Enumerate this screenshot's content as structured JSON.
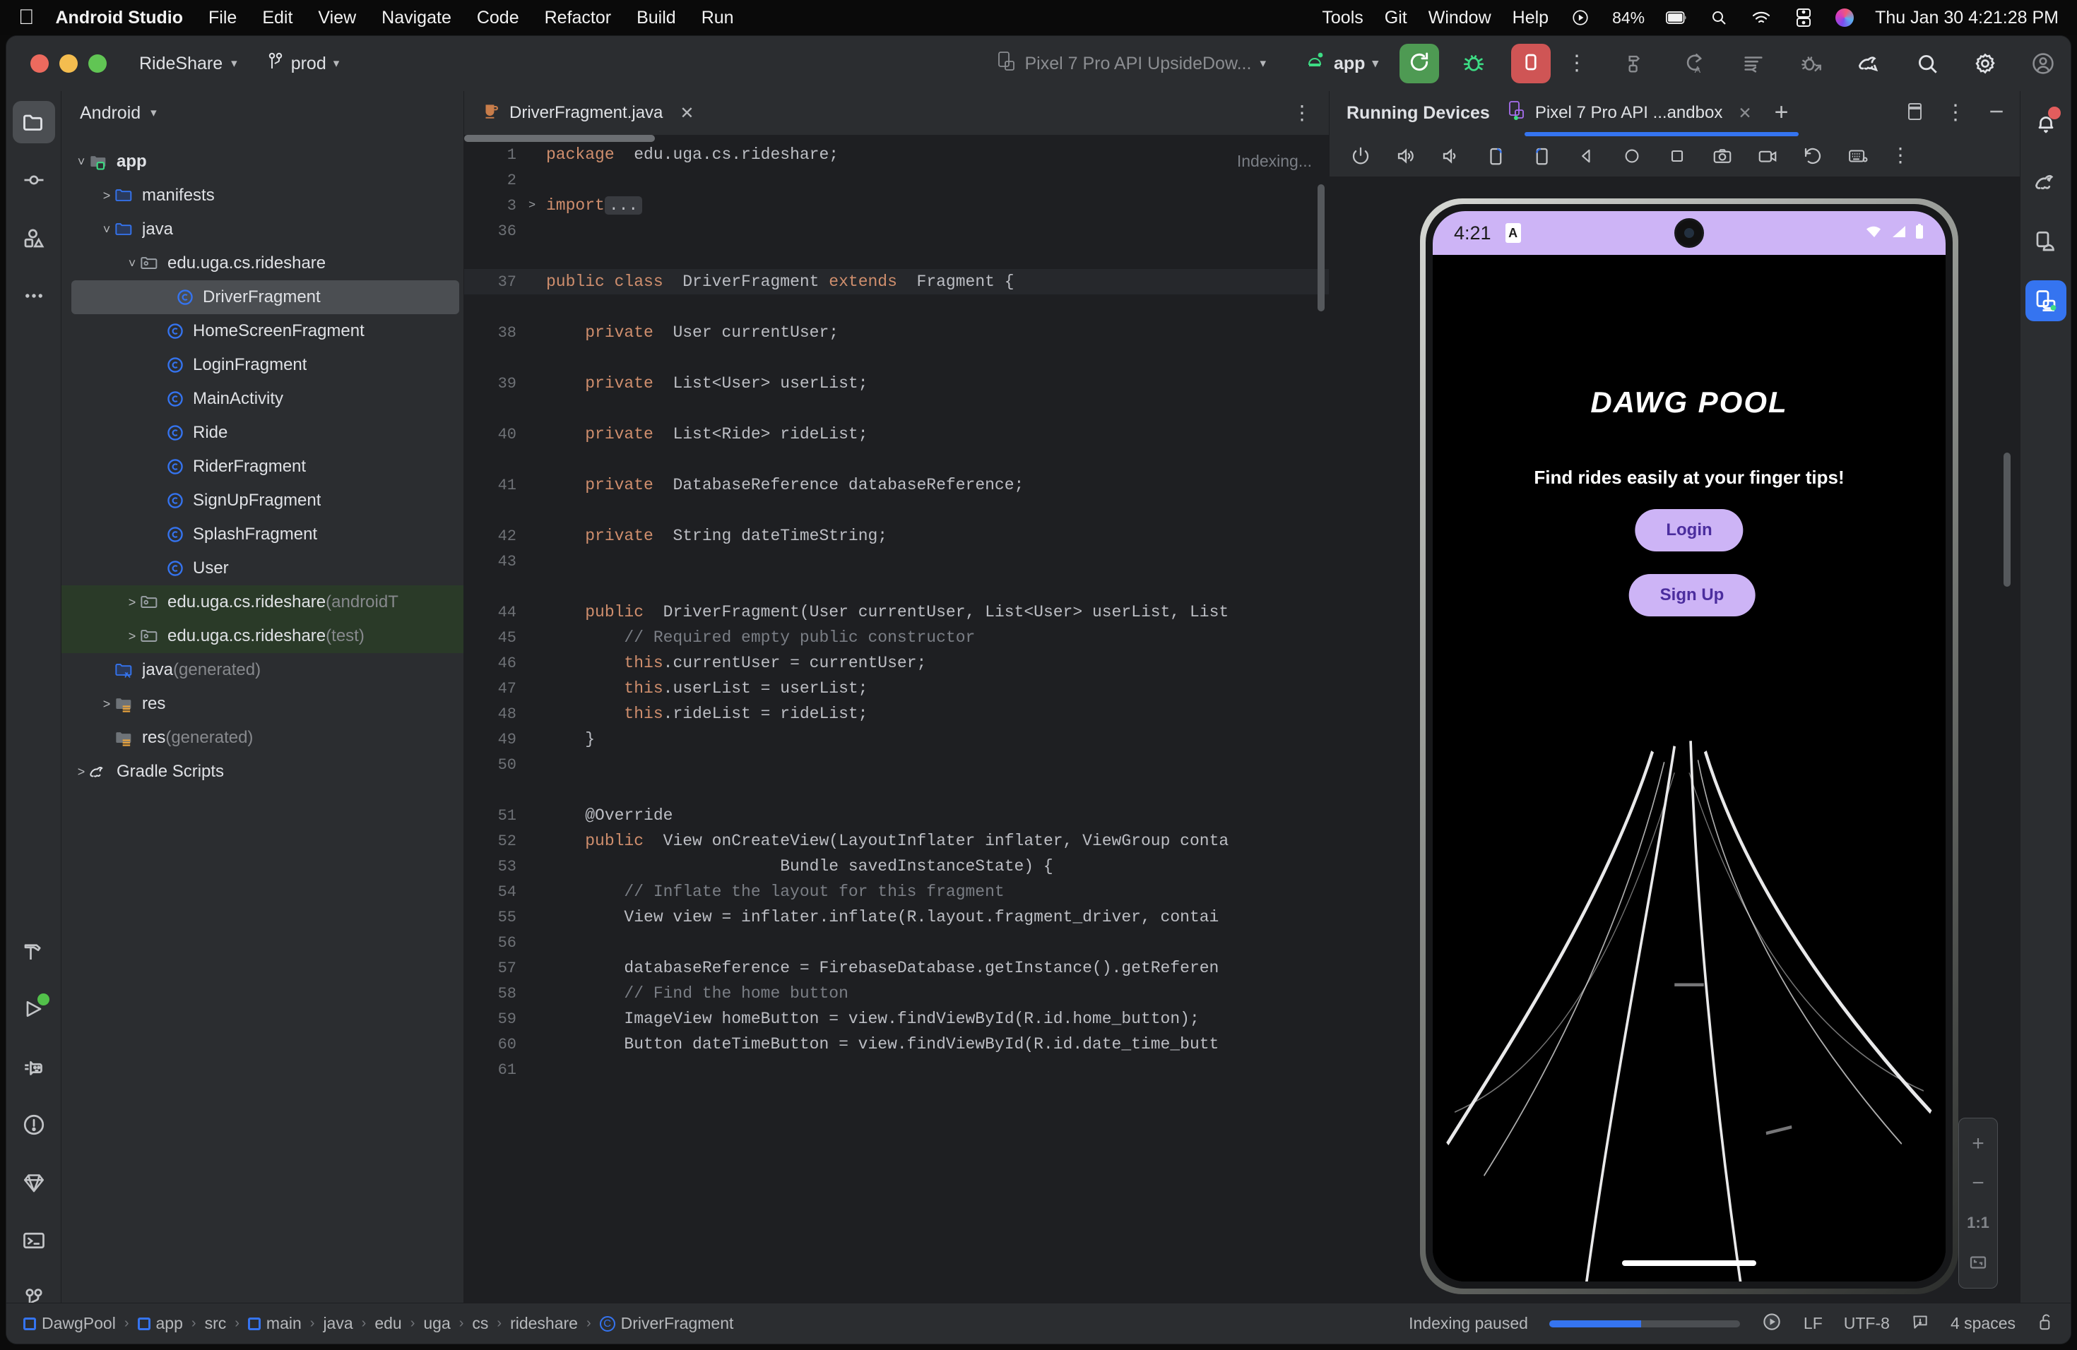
{
  "macos": {
    "apple_icon": "apple-logo-icon",
    "app_name": "Android Studio",
    "menus": [
      "File",
      "Edit",
      "View",
      "Navigate",
      "Code",
      "Refactor",
      "Build",
      "Run"
    ],
    "right_menus": [
      "Tools",
      "Git",
      "Window",
      "Help"
    ],
    "battery_percent": "84%",
    "datetime": "Thu Jan 30  4:21:28 PM",
    "icons": [
      "control-center-play-icon",
      "battery-icon",
      "search-icon",
      "wifi-icon",
      "control-center-icon",
      "siri-icon"
    ]
  },
  "toolbar": {
    "project_name": "RideShare",
    "branch_name": "prod",
    "device_target": "Pixel 7 Pro API UpsideDow...",
    "run_config": "app",
    "run_button": "run-icon",
    "debug_button": "debug-icon",
    "stop_button": "stop-icon",
    "more_button": "more-vertical-icon",
    "right_icons": [
      "build-icon",
      "code-with-me-icon",
      "format-icon",
      "debug-attach-icon",
      "gradle-sync-icon",
      "search-everywhere-icon",
      "settings-icon",
      "account-icon"
    ]
  },
  "left_toolbar": {
    "items": [
      {
        "name": "project",
        "icon": "folder-icon",
        "active": true
      },
      {
        "name": "commit",
        "icon": "commit-icon",
        "active": false
      },
      {
        "name": "resource-manager",
        "icon": "shapes-icon",
        "active": false
      },
      {
        "name": "more-tool-windows",
        "icon": "ellipsis-icon",
        "active": false
      }
    ],
    "bottom_items": [
      {
        "name": "build",
        "icon": "hammer-icon"
      },
      {
        "name": "run",
        "icon": "play-icon",
        "badge": true
      },
      {
        "name": "logcat",
        "icon": "cat-icon"
      },
      {
        "name": "problems",
        "icon": "warning-circle-icon"
      },
      {
        "name": "app-quality-insights",
        "icon": "diamond-icon"
      },
      {
        "name": "terminal",
        "icon": "terminal-icon"
      },
      {
        "name": "version-control",
        "icon": "branch-icon"
      }
    ]
  },
  "right_toolbar": {
    "items": [
      {
        "name": "notifications",
        "icon": "bell-icon",
        "badge": true,
        "active": false
      },
      {
        "name": "gradle",
        "icon": "gradle-elephant-icon",
        "badge": false,
        "active": false
      },
      {
        "name": "device-manager",
        "icon": "device-android-icon",
        "badge": false,
        "active": false
      },
      {
        "name": "running-devices",
        "icon": "running-devices-icon",
        "badge": true,
        "active": true
      }
    ]
  },
  "project_panel": {
    "title": "Android",
    "tree": [
      {
        "indent": 0,
        "twisty": "down",
        "icon": "module-folder-icon",
        "label": "app",
        "suffix": "",
        "bold": true,
        "selected": false,
        "scope": false
      },
      {
        "indent": 1,
        "twisty": "right",
        "icon": "folder-blue-icon",
        "label": "manifests",
        "suffix": "",
        "bold": false,
        "selected": false,
        "scope": false
      },
      {
        "indent": 1,
        "twisty": "down",
        "icon": "folder-blue-icon",
        "label": "java",
        "suffix": "",
        "bold": false,
        "selected": false,
        "scope": false
      },
      {
        "indent": 2,
        "twisty": "down",
        "icon": "package-icon",
        "label": "edu.uga.cs.rideshare",
        "suffix": "",
        "bold": false,
        "selected": false,
        "scope": false
      },
      {
        "indent": 3,
        "twisty": "none",
        "icon": "java-class-icon",
        "label": "DriverFragment",
        "suffix": "",
        "bold": false,
        "selected": true,
        "scope": false
      },
      {
        "indent": 3,
        "twisty": "none",
        "icon": "java-class-icon",
        "label": "HomeScreenFragment",
        "suffix": "",
        "bold": false,
        "selected": false,
        "scope": false
      },
      {
        "indent": 3,
        "twisty": "none",
        "icon": "java-class-icon",
        "label": "LoginFragment",
        "suffix": "",
        "bold": false,
        "selected": false,
        "scope": false
      },
      {
        "indent": 3,
        "twisty": "none",
        "icon": "java-class-icon",
        "label": "MainActivity",
        "suffix": "",
        "bold": false,
        "selected": false,
        "scope": false
      },
      {
        "indent": 3,
        "twisty": "none",
        "icon": "java-class-icon",
        "label": "Ride",
        "suffix": "",
        "bold": false,
        "selected": false,
        "scope": false
      },
      {
        "indent": 3,
        "twisty": "none",
        "icon": "java-class-icon",
        "label": "RiderFragment",
        "suffix": "",
        "bold": false,
        "selected": false,
        "scope": false
      },
      {
        "indent": 3,
        "twisty": "none",
        "icon": "java-class-icon",
        "label": "SignUpFragment",
        "suffix": "",
        "bold": false,
        "selected": false,
        "scope": false
      },
      {
        "indent": 3,
        "twisty": "none",
        "icon": "java-class-icon",
        "label": "SplashFragment",
        "suffix": "",
        "bold": false,
        "selected": false,
        "scope": false
      },
      {
        "indent": 3,
        "twisty": "none",
        "icon": "java-class-icon",
        "label": "User",
        "suffix": "",
        "bold": false,
        "selected": false,
        "scope": false
      },
      {
        "indent": 2,
        "twisty": "right",
        "icon": "package-icon",
        "label": "edu.uga.cs.rideshare",
        "suffix": " (androidT",
        "bold": false,
        "selected": false,
        "scope": true
      },
      {
        "indent": 2,
        "twisty": "right",
        "icon": "package-icon",
        "label": "edu.uga.cs.rideshare",
        "suffix": " (test)",
        "bold": false,
        "selected": false,
        "scope": true
      },
      {
        "indent": 1,
        "twisty": "none",
        "icon": "folder-generated-icon",
        "label": "java",
        "suffix": " (generated)",
        "bold": false,
        "selected": false,
        "scope": false
      },
      {
        "indent": 1,
        "twisty": "right",
        "icon": "folder-res-icon",
        "label": "res",
        "suffix": "",
        "bold": false,
        "selected": false,
        "scope": false
      },
      {
        "indent": 1,
        "twisty": "none",
        "icon": "folder-res-icon",
        "label": "res",
        "suffix": " (generated)",
        "bold": false,
        "selected": false,
        "scope": false
      },
      {
        "indent": 0,
        "twisty": "right",
        "icon": "gradle-elephant-icon",
        "label": "Gradle Scripts",
        "suffix": "",
        "bold": false,
        "selected": false,
        "scope": false
      }
    ]
  },
  "editor": {
    "tab_label": "DriverFragment.java",
    "tab_icon": "java-file-icon",
    "close_icon": "close-icon",
    "options_icon": "more-vertical-icon",
    "indexing_label": "Indexing...",
    "lines": [
      {
        "num": "1",
        "fold": "",
        "indent": 0,
        "tokens": [
          [
            "kw",
            "package"
          ],
          [
            "",
            "  edu.uga.cs.rideshare;"
          ]
        ],
        "highlight": false
      },
      {
        "num": "2",
        "fold": "",
        "indent": 0,
        "tokens": [],
        "highlight": false
      },
      {
        "num": "3",
        "fold": ">",
        "indent": 0,
        "tokens": [
          [
            "kw",
            "import"
          ],
          [
            "",
            ""
          ],
          [
            "fold",
            "..."
          ]
        ],
        "highlight": false
      },
      {
        "num": "36",
        "fold": "",
        "indent": 0,
        "tokens": [],
        "highlight": false
      },
      {
        "num": "",
        "fold": "",
        "indent": 0,
        "tokens": [],
        "highlight": false
      },
      {
        "num": "37",
        "fold": "",
        "indent": 0,
        "tokens": [
          [
            "kw",
            "public class"
          ],
          [
            "",
            "  DriverFragment "
          ],
          [
            "kw",
            "extends"
          ],
          [
            "",
            "  Fragment {"
          ]
        ],
        "highlight": true
      },
      {
        "num": "",
        "fold": "",
        "indent": 0,
        "tokens": [],
        "highlight": false
      },
      {
        "num": "38",
        "fold": "",
        "indent": 1,
        "tokens": [
          [
            "kw",
            "private"
          ],
          [
            "",
            "  User currentUser;"
          ]
        ],
        "highlight": false
      },
      {
        "num": "",
        "fold": "",
        "indent": 0,
        "tokens": [],
        "highlight": false
      },
      {
        "num": "39",
        "fold": "",
        "indent": 1,
        "tokens": [
          [
            "kw",
            "private"
          ],
          [
            "",
            "  List<User> userList;"
          ]
        ],
        "highlight": false
      },
      {
        "num": "",
        "fold": "",
        "indent": 0,
        "tokens": [],
        "highlight": false
      },
      {
        "num": "40",
        "fold": "",
        "indent": 1,
        "tokens": [
          [
            "kw",
            "private"
          ],
          [
            "",
            "  List<Ride> rideList;"
          ]
        ],
        "highlight": false
      },
      {
        "num": "",
        "fold": "",
        "indent": 0,
        "tokens": [],
        "highlight": false
      },
      {
        "num": "41",
        "fold": "",
        "indent": 1,
        "tokens": [
          [
            "kw",
            "private"
          ],
          [
            "",
            "  DatabaseReference databaseReference;"
          ]
        ],
        "highlight": false
      },
      {
        "num": "",
        "fold": "",
        "indent": 0,
        "tokens": [],
        "highlight": false
      },
      {
        "num": "42",
        "fold": "",
        "indent": 1,
        "tokens": [
          [
            "kw",
            "private"
          ],
          [
            "",
            "  String dateTimeString;"
          ]
        ],
        "highlight": false
      },
      {
        "num": "43",
        "fold": "",
        "indent": 0,
        "tokens": [],
        "highlight": false
      },
      {
        "num": "",
        "fold": "",
        "indent": 0,
        "tokens": [],
        "highlight": false
      },
      {
        "num": "44",
        "fold": "",
        "indent": 1,
        "tokens": [
          [
            "kw",
            "public"
          ],
          [
            "",
            "  DriverFragment(User currentUser, List<User> userList, List"
          ]
        ],
        "highlight": false
      },
      {
        "num": "45",
        "fold": "",
        "indent": 2,
        "tokens": [
          [
            "cmt",
            "// Required empty public constructor"
          ]
        ],
        "highlight": false
      },
      {
        "num": "46",
        "fold": "",
        "indent": 2,
        "tokens": [
          [
            "kw",
            "this"
          ],
          [
            "",
            ".currentUser = currentUser;"
          ]
        ],
        "highlight": false
      },
      {
        "num": "47",
        "fold": "",
        "indent": 2,
        "tokens": [
          [
            "kw",
            "this"
          ],
          [
            "",
            ".userList = userList;"
          ]
        ],
        "highlight": false
      },
      {
        "num": "48",
        "fold": "",
        "indent": 2,
        "tokens": [
          [
            "kw",
            "this"
          ],
          [
            "",
            ".rideList = rideList;"
          ]
        ],
        "highlight": false
      },
      {
        "num": "49",
        "fold": "",
        "indent": 1,
        "tokens": [
          [
            "",
            "}"
          ]
        ],
        "highlight": false
      },
      {
        "num": "50",
        "fold": "",
        "indent": 0,
        "tokens": [],
        "highlight": false
      },
      {
        "num": "",
        "fold": "",
        "indent": 0,
        "tokens": [],
        "highlight": false
      },
      {
        "num": "51",
        "fold": "",
        "indent": 1,
        "tokens": [
          [
            "",
            "@Override"
          ]
        ],
        "highlight": false
      },
      {
        "num": "52",
        "fold": "",
        "indent": 1,
        "tokens": [
          [
            "kw",
            "public"
          ],
          [
            "",
            "  View onCreateView(LayoutInflater inflater, ViewGroup conta"
          ]
        ],
        "highlight": false
      },
      {
        "num": "53",
        "fold": "",
        "indent": 6,
        "tokens": [
          [
            "",
            "Bundle savedInstanceState) {"
          ]
        ],
        "highlight": false
      },
      {
        "num": "54",
        "fold": "",
        "indent": 2,
        "tokens": [
          [
            "cmt",
            "// Inflate the layout for this fragment"
          ]
        ],
        "highlight": false
      },
      {
        "num": "55",
        "fold": "",
        "indent": 2,
        "tokens": [
          [
            "",
            "View view = inflater.inflate(R.layout.fragment_driver, contai"
          ]
        ],
        "highlight": false
      },
      {
        "num": "56",
        "fold": "",
        "indent": 0,
        "tokens": [],
        "highlight": false
      },
      {
        "num": "57",
        "fold": "",
        "indent": 2,
        "tokens": [
          [
            "",
            "databaseReference = FirebaseDatabase.getInstance().getReferen"
          ]
        ],
        "highlight": false
      },
      {
        "num": "58",
        "fold": "",
        "indent": 2,
        "tokens": [
          [
            "cmt",
            "// Find the home button"
          ]
        ],
        "highlight": false
      },
      {
        "num": "59",
        "fold": "",
        "indent": 2,
        "tokens": [
          [
            "",
            "ImageView homeButton = view.findViewById(R.id.home_button);"
          ]
        ],
        "highlight": false
      },
      {
        "num": "60",
        "fold": "",
        "indent": 2,
        "tokens": [
          [
            "",
            "Button dateTimeButton = view.findViewById(R.id.date_time_butt"
          ]
        ],
        "highlight": false
      },
      {
        "num": "61",
        "fold": "",
        "indent": 0,
        "tokens": [],
        "highlight": false
      }
    ]
  },
  "running_devices": {
    "title": "Running Devices",
    "tab_label": "Pixel 7 Pro API ...andbox",
    "tab_icon": "device-icon",
    "close_icon": "close-icon",
    "add_icon": "plus-icon",
    "layout_icon": "split-layout-icon",
    "options_icon": "more-vertical-icon",
    "minimize_icon": "minimize-icon",
    "toolbar_icons": [
      "power-icon",
      "volume-up-icon",
      "volume-down-icon",
      "rotate-left-icon",
      "rotate-right-icon",
      "back-icon",
      "home-icon",
      "overview-icon",
      "screenshot-icon",
      "record-icon",
      "restore-icon",
      "keyboard-icon",
      "more-vertical-icon"
    ],
    "zoom_controls": {
      "zoom_in": "+",
      "zoom_out": "−",
      "actual_size": "1:1",
      "fit_to_screen": "fit-icon"
    }
  },
  "emulator": {
    "status_time": "4:21",
    "status_app_icon": "app-notification-icon",
    "status_icons": [
      "wifi-icon",
      "signal-icon",
      "battery-icon"
    ],
    "app_title": "DAWG POOL",
    "app_tagline": "Find rides easily at your finger tips!",
    "login_button": "Login",
    "signup_button": "Sign Up",
    "accent_color": "#cdb4f6",
    "button_text_color": "#4b2d9e"
  },
  "status_bar": {
    "breadcrumbs": [
      {
        "label": "DawgPool",
        "icon": "module-icon"
      },
      {
        "label": "app",
        "icon": "module-icon"
      },
      {
        "label": "src",
        "icon": ""
      },
      {
        "label": "main",
        "icon": "module-icon"
      },
      {
        "label": "java",
        "icon": ""
      },
      {
        "label": "edu",
        "icon": ""
      },
      {
        "label": "uga",
        "icon": ""
      },
      {
        "label": "cs",
        "icon": ""
      },
      {
        "label": "rideshare",
        "icon": ""
      },
      {
        "label": "DriverFragment",
        "icon": "java-class-icon"
      }
    ],
    "indexing_text": "Indexing paused",
    "progress_percent": 48,
    "resume_icon": "play-circle-icon",
    "line_separator": "LF",
    "encoding": "UTF-8",
    "inspections_icon": "inspections-icon",
    "indent": "4 spaces",
    "lock_icon": "unlock-icon"
  }
}
